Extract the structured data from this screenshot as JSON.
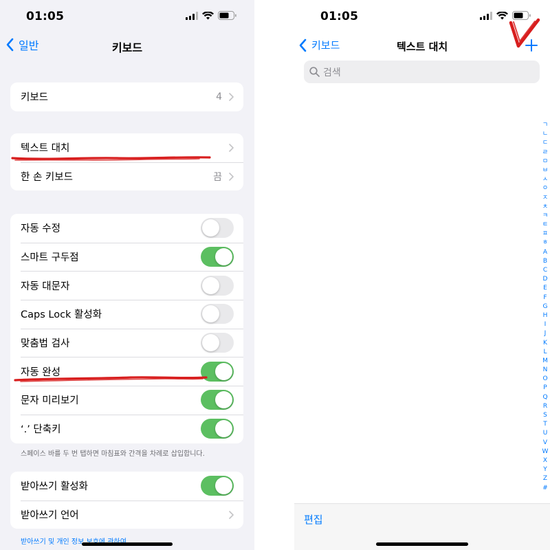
{
  "left": {
    "status_time": "01:05",
    "back_label": "일반",
    "title": "키보드",
    "group1": [
      {
        "label": "키보드",
        "value": "4"
      }
    ],
    "group2": [
      {
        "label": "텍스트 대치"
      },
      {
        "label": "한 손 키보드",
        "value": "끔"
      }
    ],
    "group3": [
      {
        "label": "자동 수정",
        "on": false
      },
      {
        "label": "스마트 구두점",
        "on": true
      },
      {
        "label": "자동 대문자",
        "on": false
      },
      {
        "label": "Caps Lock 활성화",
        "on": false
      },
      {
        "label": "맞춤법 검사",
        "on": false
      },
      {
        "label": "자동 완성",
        "on": true
      },
      {
        "label": "문자 미리보기",
        "on": true
      },
      {
        "label": "‘.’ 단축키",
        "on": true
      }
    ],
    "group3_footnote": "스페이스 바를 두 번 탭하면 마침표와 간격을 차례로 삽입합니다.",
    "group4": [
      {
        "label": "받아쓰기 활성화",
        "on": true
      },
      {
        "label": "받아쓰기 언어"
      }
    ],
    "group4_footnote": "받아쓰기 및 개인 정보 보호에 관하여..."
  },
  "right": {
    "status_time": "01:05",
    "back_label": "키보드",
    "title": "텍스트 대치",
    "add_icon": "plus-icon",
    "search_placeholder": "검색",
    "index_letters": [
      "ㄱ",
      "ㄴ",
      "ㄷ",
      "ㄹ",
      "ㅁ",
      "ㅂ",
      "ㅅ",
      "ㅇ",
      "ㅈ",
      "ㅊ",
      "ㅋ",
      "ㅌ",
      "ㅍ",
      "ㅎ",
      "A",
      "B",
      "C",
      "D",
      "E",
      "F",
      "G",
      "H",
      "I",
      "J",
      "K",
      "L",
      "M",
      "N",
      "O",
      "P",
      "Q",
      "R",
      "S",
      "T",
      "U",
      "V",
      "W",
      "X",
      "Y",
      "Z",
      "#"
    ],
    "edit_label": "편집"
  },
  "colors": {
    "accent": "#007aff",
    "toggle_on": "#5cbf61",
    "annotation_red": "#d81e1e"
  }
}
